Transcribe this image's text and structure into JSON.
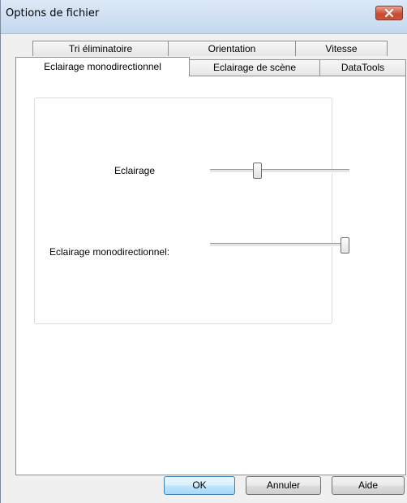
{
  "window": {
    "title": "Options de fichier"
  },
  "tabs": {
    "row1": [
      {
        "label": "Tri éliminatoire"
      },
      {
        "label": "Orientation"
      },
      {
        "label": "Vitesse"
      }
    ],
    "row2": [
      {
        "label": "Eclairage monodirectionnel",
        "selected": true
      },
      {
        "label": "Eclairage de scène"
      },
      {
        "label": "DataTools"
      }
    ]
  },
  "panel": {
    "eclairage": {
      "label": "Eclairage",
      "slider_value": 0.33
    },
    "mono": {
      "label": "Eclairage monodirectionnel:",
      "slider_value": 1.0
    }
  },
  "buttons": {
    "ok": "OK",
    "cancel": "Annuler",
    "help": "Aide"
  }
}
